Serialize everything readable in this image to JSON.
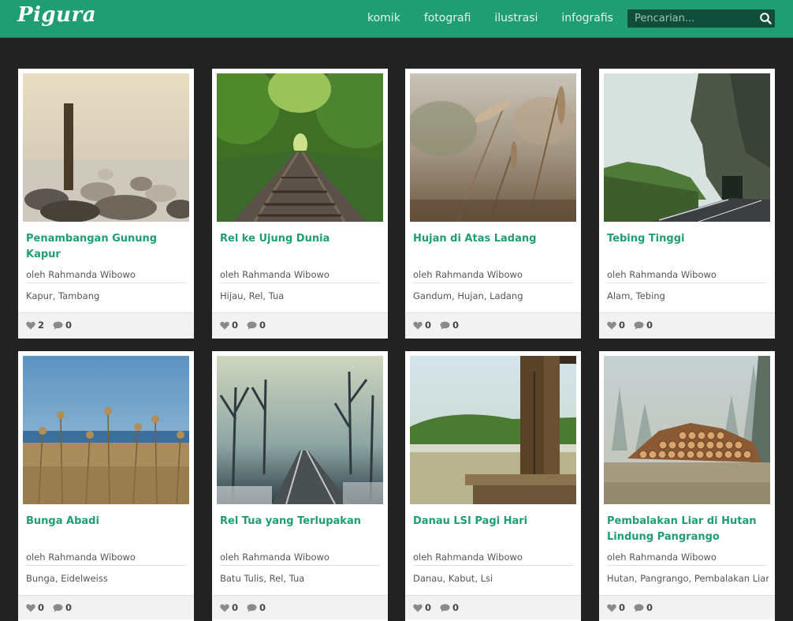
{
  "header": {
    "logo": "Pigura",
    "nav": [
      "komik",
      "fotografi",
      "ilustrasi",
      "infografis"
    ],
    "search_placeholder": "Pencarian..."
  },
  "cards": [
    {
      "title": "Penambangan Gunung Kapur",
      "author": "oleh Rahmanda Wibowo",
      "tags": "Kapur, Tambang",
      "likes": "2",
      "comments": "0",
      "image": "stones-and-post-by-calm-sea"
    },
    {
      "title": "Rel ke Ujung Dunia",
      "author": "oleh Rahmanda Wibowo",
      "tags": "Hijau, Rel, Tua",
      "likes": "0",
      "comments": "0",
      "image": "railway-through-green-forest"
    },
    {
      "title": "Hujan di Atas Ladang",
      "author": "oleh Rahmanda Wibowo",
      "tags": "Gandum, Hujan, Ladang",
      "likes": "0",
      "comments": "0",
      "image": "wheat-stalks-close-up"
    },
    {
      "title": "Tebing Tinggi",
      "author": "oleh Rahmanda Wibowo",
      "tags": "Alam, Tebing",
      "likes": "0",
      "comments": "0",
      "image": "road-under-rock-cliff"
    },
    {
      "title": "Bunga Abadi",
      "author": "oleh Rahmanda Wibowo",
      "tags": "Bunga, Eidelweiss",
      "likes": "0",
      "comments": "0",
      "image": "dried-flowers-blue-sky"
    },
    {
      "title": "Rel Tua yang Terlupakan",
      "author": "oleh Rahmanda Wibowo",
      "tags": "Batu Tulis, Rel, Tua",
      "likes": "0",
      "comments": "0",
      "image": "foggy-railway-bare-trees"
    },
    {
      "title": "Danau LSI Pagi Hari",
      "author": "oleh Rahmanda Wibowo",
      "tags": "Danau, Kabut, Lsi",
      "likes": "0",
      "comments": "0",
      "image": "misty-lake-wooden-pier"
    },
    {
      "title": "Pembalakan Liar di Hutan Lindung Pangrango",
      "author": "oleh Rahmanda Wibowo",
      "tags": "Hutan, Pangrango, Pembalakan Liar",
      "likes": "0",
      "comments": "0",
      "image": "stacked-logs-foggy-forest"
    }
  ],
  "colors": {
    "brand": "#1f9e73",
    "background": "#222222",
    "card": "#ffffff"
  }
}
